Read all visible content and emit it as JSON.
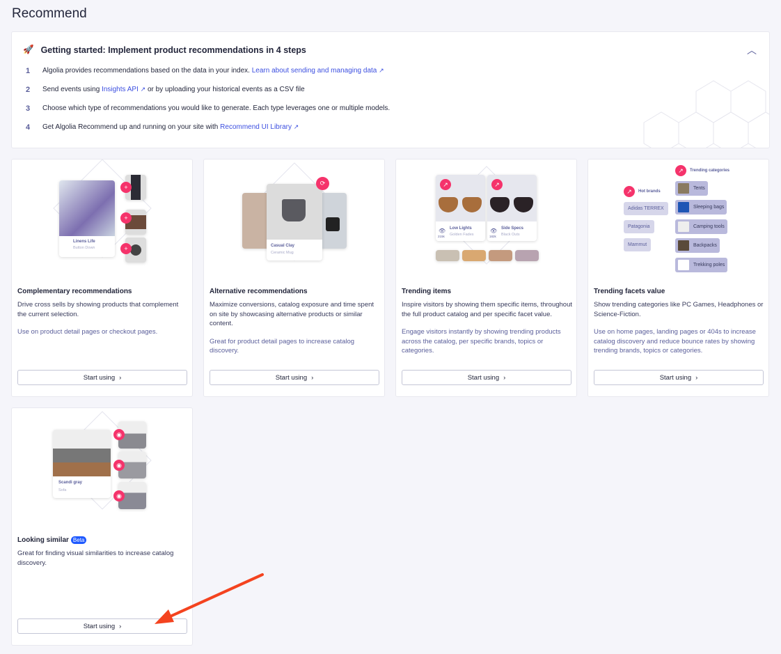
{
  "page": {
    "title": "Recommend"
  },
  "getting_started": {
    "title": "Getting started: Implement product recommendations in 4 steps",
    "steps": [
      {
        "n": "1",
        "text": "Algolia provides recommendations based on the data in your index. ",
        "link": "Learn about sending and managing data",
        "after": ""
      },
      {
        "n": "2",
        "text": "Send events using ",
        "link": "Insights API",
        "after": " or by uploading your historical events as a CSV file"
      },
      {
        "n": "3",
        "text": "Choose which type of recommendations you would like to generate. Each type leverages one or multiple models.",
        "link": "",
        "after": ""
      },
      {
        "n": "4",
        "text": "Get Algolia Recommend up and running on your site with ",
        "link": "Recommend UI Library",
        "after": ""
      }
    ]
  },
  "cards": [
    {
      "title": "Complementary recommendations",
      "desc": "Drive cross sells by showing products that complement the current selection.",
      "use": "Use on product detail pages or checkout pages.",
      "button": "Start using",
      "illus": {
        "name": "Linens Life",
        "sub": "Button Down"
      }
    },
    {
      "title": "Alternative recommendations",
      "desc": "Maximize conversions, catalog exposure and time spent on site by showcasing alternative products or similar content.",
      "use": "Great for product detail pages to increase catalog discovery.",
      "button": "Start using",
      "illus": {
        "name": "Casual Clay",
        "sub": "Ceramic Mug"
      }
    },
    {
      "title": "Trending items",
      "desc": "Inspire visitors by showing them specific items, throughout the full product catalog and per specific facet value.",
      "use": "Engage visitors instantly by showing trending products across the catalog, per specific brands, topics or categories.",
      "button": "Start using",
      "illus": {
        "items": [
          {
            "name": "Low Lights",
            "sub": "Golden Fades",
            "views": "215k"
          },
          {
            "name": "Side Specs",
            "sub": "Black Outs",
            "views": "182k"
          }
        ]
      }
    },
    {
      "title": "Trending facets value",
      "desc": "Show trending categories like PC Games, Headphones or Science-Fiction.",
      "use": "Use on home pages, landing pages or 404s to increase catalog discovery and reduce bounce rates by showing trending brands, topics or categories.",
      "button": "Start using",
      "illus": {
        "brands_label": "Hot brands",
        "brands": [
          "Adidas TERREX",
          "Patagonia",
          "Mammut"
        ],
        "categories_label": "Trending categories",
        "categories": [
          "Tents",
          "Sleeping bags",
          "Camping tools",
          "Backpacks",
          "Trekking poles"
        ]
      }
    },
    {
      "title": "Looking similar",
      "badge": "Beta",
      "desc": "Great for finding visual similarities to increase catalog discovery.",
      "use": "",
      "button": "Start using",
      "illus": {
        "name": "Scandi gray",
        "sub": "Sofa"
      }
    }
  ],
  "colors": {
    "accent": "#3c4fe0",
    "pink": "#f5336b",
    "annotation_arrow": "#f4431f"
  }
}
